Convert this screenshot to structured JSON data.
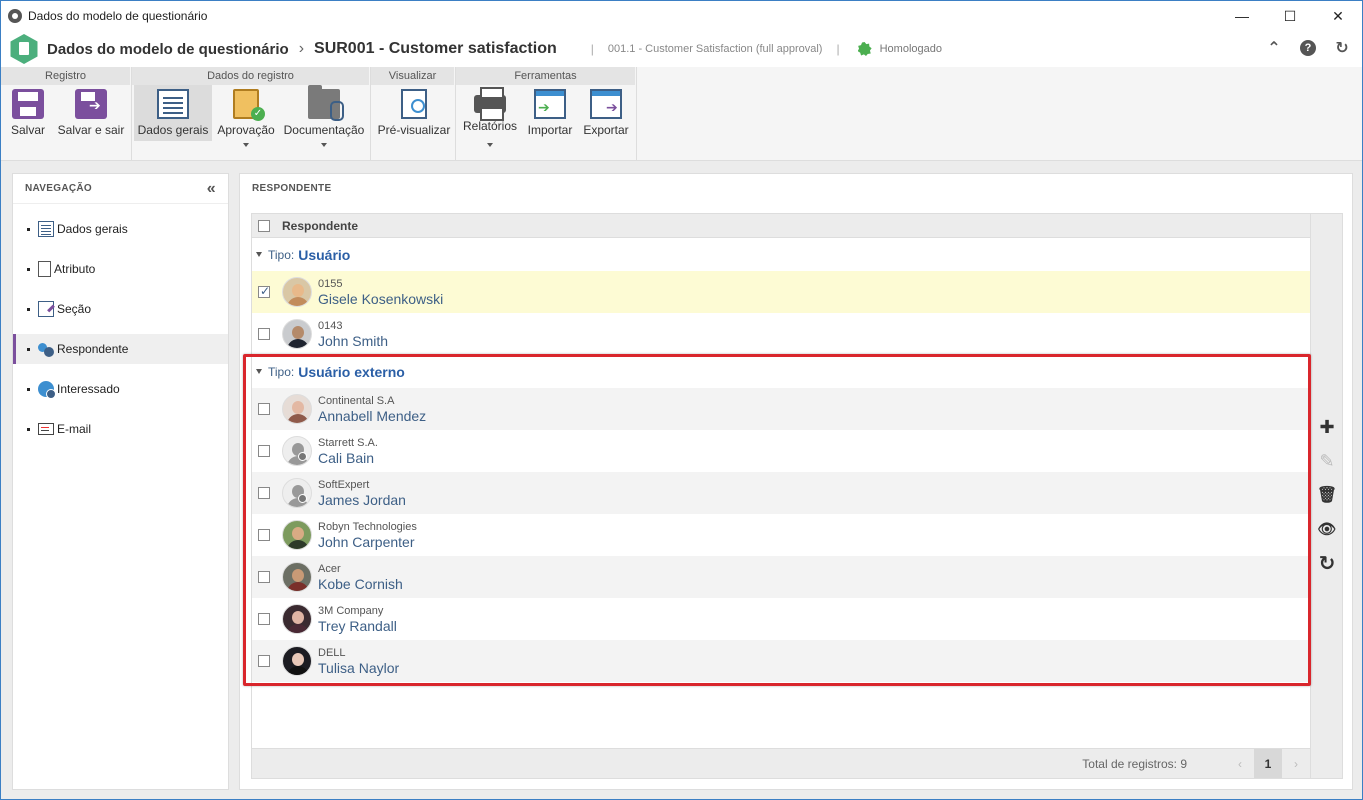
{
  "window": {
    "title": "Dados do modelo de questionário",
    "minimize": "—",
    "maximize": "☐",
    "close": "✕"
  },
  "header": {
    "breadcrumb_parent": "Dados do modelo de questionário",
    "breadcrumb_sep": "›",
    "record_title": "SUR001 - Customer satisfaction",
    "revision_sep": "|",
    "revision": "001.1 - Customer Satisfaction (full approval)",
    "status_sep": "|",
    "status": "Homologado",
    "collapse_glyph": "⌃",
    "help_glyph": "?",
    "refresh_glyph": "↻"
  },
  "ribbon": {
    "groups": [
      {
        "title": "Registro"
      },
      {
        "title": "Dados do registro"
      },
      {
        "title": "Visualizar"
      },
      {
        "title": "Ferramentas"
      }
    ],
    "buttons": {
      "save": "Salvar",
      "save_exit": "Salvar e sair",
      "general": "Dados gerais",
      "approval": "Aprovação",
      "documentation": "Documentação",
      "preview": "Pré-visualizar",
      "reports": "Relatórios",
      "import": "Importar",
      "export": "Exportar"
    }
  },
  "nav": {
    "title": "NAVEGAÇÃO",
    "collapse_glyph": "«",
    "items": [
      {
        "label": "Dados gerais",
        "icon": "list-icon"
      },
      {
        "label": "Atributo",
        "icon": "page-icon"
      },
      {
        "label": "Seção",
        "icon": "section-icon"
      },
      {
        "label": "Respondente",
        "icon": "users-icon",
        "active": true
      },
      {
        "label": "Interessado",
        "icon": "globe-users-icon"
      },
      {
        "label": "E-mail",
        "icon": "email-icon"
      }
    ]
  },
  "main": {
    "title": "RESPONDENTE",
    "column": "Respondente",
    "type_label": "Tipo:",
    "groups": [
      {
        "value": "Usuário",
        "rows": [
          {
            "top": "0155",
            "name": "Gisele Kosenkowski",
            "checked": true
          },
          {
            "top": "0143",
            "name": "John Smith",
            "checked": false
          }
        ]
      },
      {
        "value": "Usuário externo",
        "rows": [
          {
            "top": "Continental S.A",
            "name": "Annabell Mendez"
          },
          {
            "top": "Starrett S.A.",
            "name": "Cali Bain"
          },
          {
            "top": "SoftExpert",
            "name": "James Jordan"
          },
          {
            "top": "Robyn Technologies",
            "name": "John Carpenter"
          },
          {
            "top": "Acer",
            "name": "Kobe Cornish"
          },
          {
            "top": "3M Company",
            "name": "Trey Randall"
          },
          {
            "top": "DELL",
            "name": "Tulisa Naylor"
          }
        ]
      }
    ],
    "total_label": "Total de registros: 9",
    "pager": {
      "prev": "‹",
      "current": "1",
      "next": "›"
    }
  },
  "toolbar": {
    "add": "✚",
    "edit": "✎",
    "delete": "🗑",
    "view": "👁",
    "refresh": "↻"
  },
  "colors": {
    "accent": "#7b4f9d",
    "link": "#3d5f86",
    "highlight": "#d9262c",
    "selected_row": "#fdfbd4"
  }
}
